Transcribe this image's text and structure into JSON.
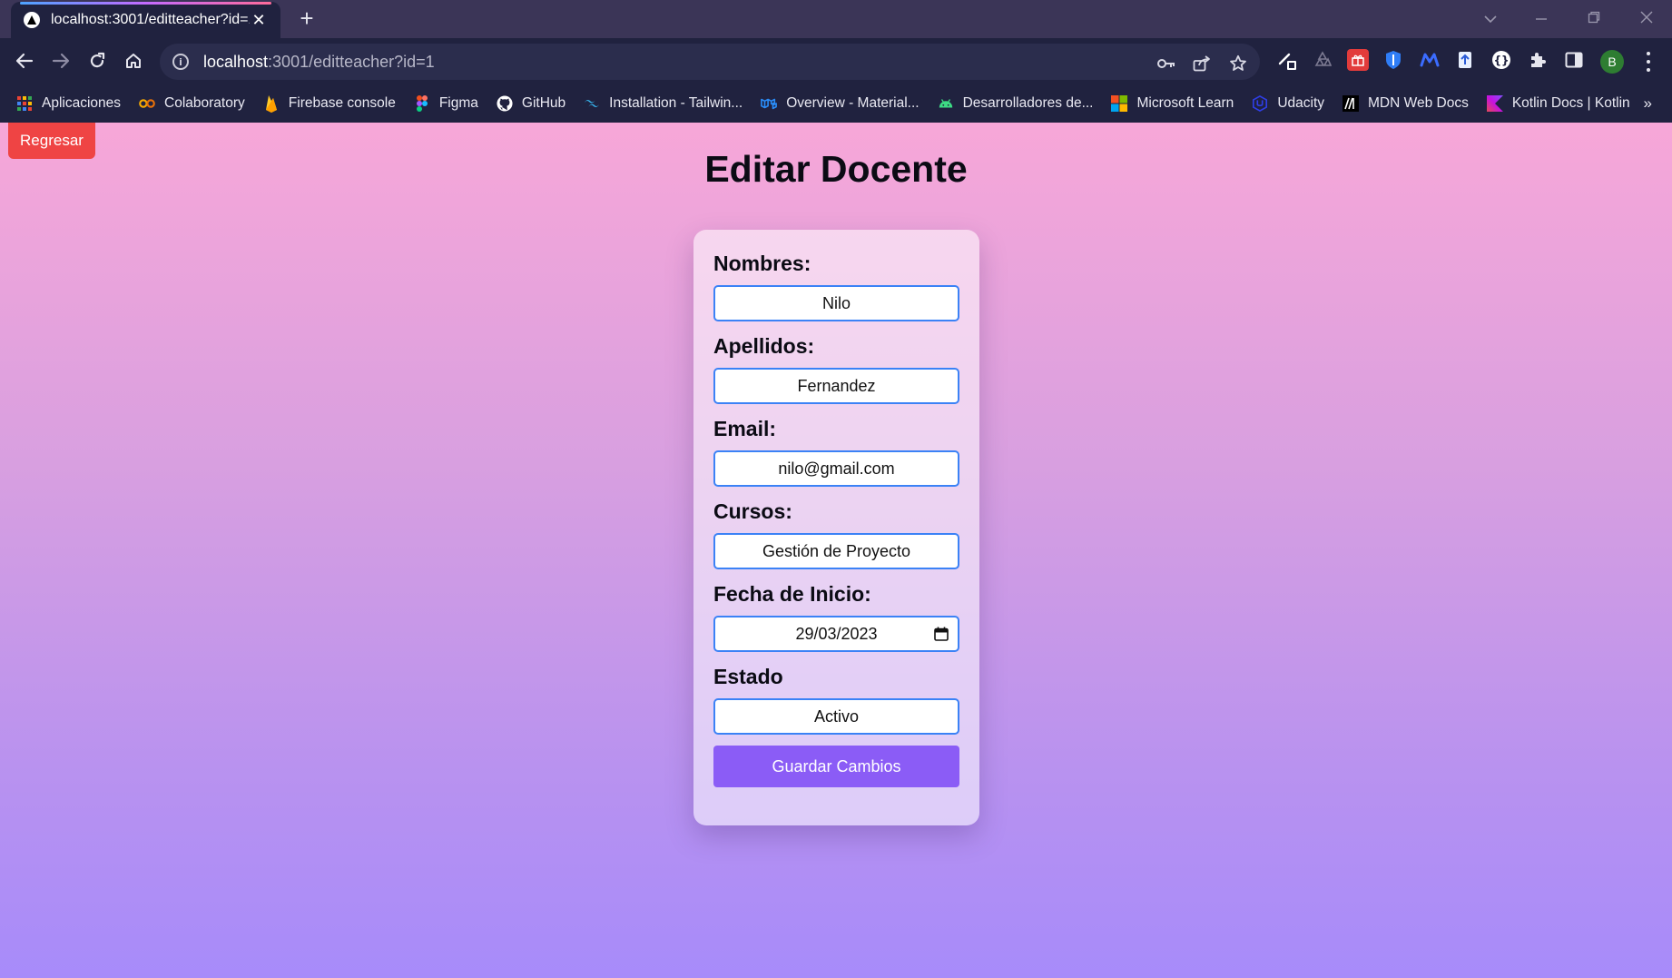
{
  "browser": {
    "tab_title": "localhost:3001/editteacher?id=1",
    "tab_close": "✕",
    "new_tab": "+",
    "url_host": "localhost",
    "url_path": ":3001/editteacher?id=1",
    "profile_initial": "B",
    "bookmarks": [
      {
        "label": "Aplicaciones",
        "icon": "apps-grid-icon"
      },
      {
        "label": "Colaboratory",
        "icon": "colab-icon"
      },
      {
        "label": "Firebase console",
        "icon": "firebase-icon"
      },
      {
        "label": "Figma",
        "icon": "figma-icon"
      },
      {
        "label": "GitHub",
        "icon": "github-icon"
      },
      {
        "label": "Installation - Tailwin...",
        "icon": "tailwind-icon"
      },
      {
        "label": "Overview - Material...",
        "icon": "material-ui-icon"
      },
      {
        "label": "Desarrolladores de...",
        "icon": "android-icon"
      },
      {
        "label": "Microsoft Learn",
        "icon": "microsoft-icon"
      },
      {
        "label": "Udacity",
        "icon": "udacity-icon"
      },
      {
        "label": "MDN Web Docs",
        "icon": "mdn-icon"
      },
      {
        "label": "Kotlin Docs | Kotlin",
        "icon": "kotlin-icon"
      }
    ],
    "bookmarks_more": "»"
  },
  "page": {
    "back_label": "Regresar",
    "title": "Editar Docente",
    "form": {
      "nombres_label": "Nombres:",
      "nombres_value": "Nilo",
      "apellidos_label": "Apellidos:",
      "apellidos_value": "Fernandez",
      "email_label": "Email:",
      "email_value": "nilo@gmail.com",
      "cursos_label": "Cursos:",
      "cursos_value": "Gestión de Proyecto",
      "fecha_label": "Fecha de Inicio:",
      "fecha_value": "29/03/2023",
      "estado_label": "Estado",
      "estado_value": "Activo",
      "save_label": "Guardar Cambios"
    }
  },
  "colors": {
    "back_button": "#ef4444",
    "save_button": "#8b5cf6",
    "input_border": "#3b82f6",
    "gradient_top": "#f7a7d8",
    "gradient_bottom": "#a78bfa"
  }
}
